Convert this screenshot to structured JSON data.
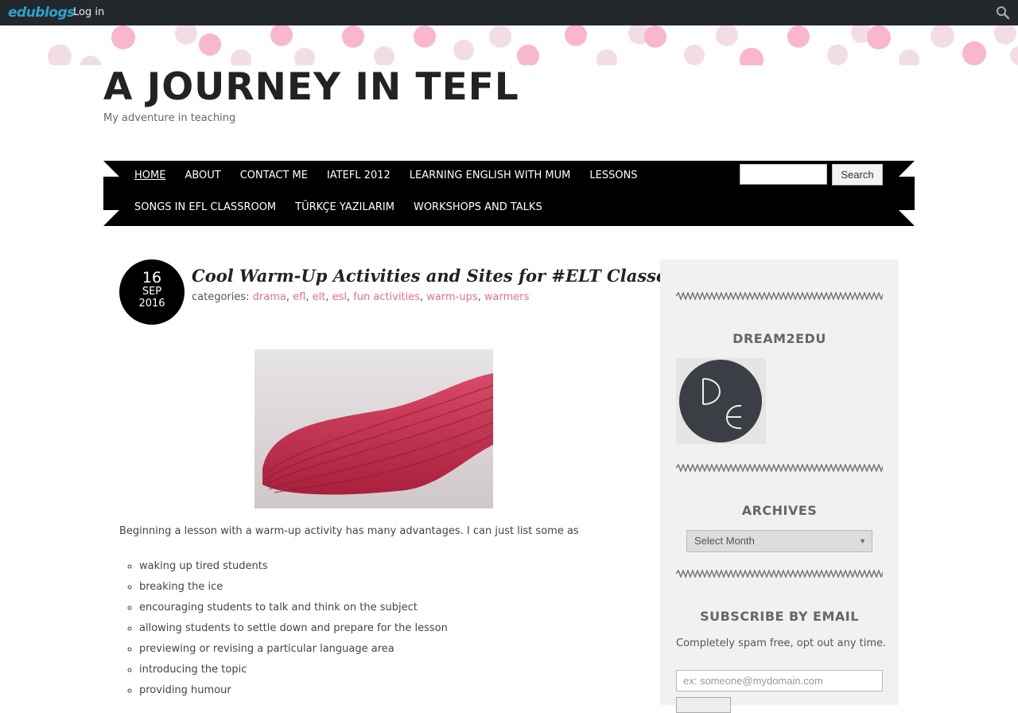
{
  "admin_bar": {
    "logo_text": "edublogs",
    "login_label": "Log in",
    "search_icon": "search-icon"
  },
  "header": {
    "title": "A JOURNEY IN TEFL",
    "description": "My adventure in teaching"
  },
  "nav": {
    "row1": [
      "HOME",
      "ABOUT",
      "CONTACT ME",
      "IATEFL 2012",
      "LEARNING ENGLISH WITH MUM",
      "LESSONS"
    ],
    "row2": [
      "SONGS IN EFL CLASSROOM",
      "TÜRKÇE YAZILARIM",
      "WORKSHOPS AND TALKS"
    ],
    "active": "HOME",
    "search_button": "Search",
    "search_value": ""
  },
  "post": {
    "date": {
      "day": "16",
      "month": "SEP",
      "year": "2016"
    },
    "title": "Cool Warm-Up Activities and Sites for #ELT Classes",
    "categories_label": "categories:",
    "categories": [
      "drama",
      "efl",
      "elt",
      "esl",
      "fun activities",
      "warm-ups",
      "warmers"
    ],
    "intro": "Beginning a lesson with a warm-up activity has many advantages. I can just list some as",
    "bullets": [
      "waking up tired students",
      "breaking the ice",
      "encouraging students to talk and think on the subject",
      "allowing students to settle down and prepare for the lesson",
      "previewing or revising a particular language area",
      "introducing the topic",
      "providing humour"
    ]
  },
  "sidebar": {
    "widget1_title": "DREAM2EDU",
    "widget2_title": "ARCHIVES",
    "archive_select": "Select Month",
    "widget3_title": "SUBSCRIBE BY EMAIL",
    "subscribe_text": "Completely spam free, opt out any time.",
    "email_placeholder": "ex: someone@mydomain.com"
  },
  "colors": {
    "admin_bar": "#23282d",
    "link_pink": "#e86f93",
    "nav_bg": "#000000",
    "dots_pink": "#f9b6cf"
  }
}
